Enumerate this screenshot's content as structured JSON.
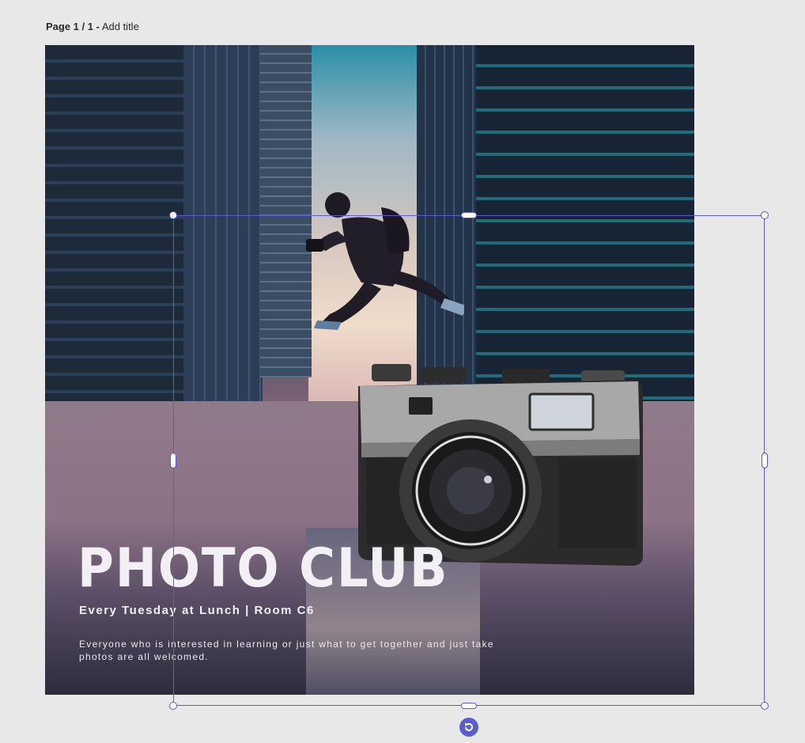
{
  "header": {
    "page_indicator": "Page 1 / 1 -",
    "title_placeholder": "Add title"
  },
  "design": {
    "title": "PHOTO CLUB",
    "subtitle": "Every Tuesday at Lunch | Room C6",
    "body": "Everyone who is interested in learning or just what to get together and just take photos are all welcomed."
  },
  "colors": {
    "selection": "#5b5bd6",
    "workspace_bg": "#e8e8e8",
    "title_text": "#f2f0f4"
  },
  "icons": {
    "rotate": "rotate-icon"
  }
}
